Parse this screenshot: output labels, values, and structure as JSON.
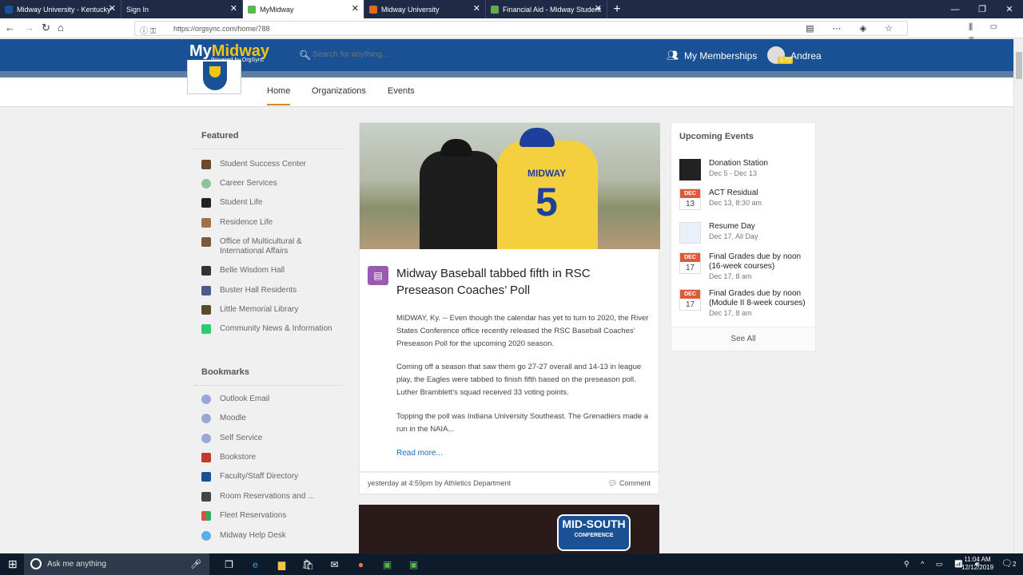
{
  "browser": {
    "tabs": [
      {
        "title": "Midway University - Kentucky",
        "fav": "#1a5094"
      },
      {
        "title": "Sign In",
        "fav": ""
      },
      {
        "title": "MyMidway",
        "fav": "#57b947"
      },
      {
        "title": "Midway University",
        "fav": "#e06b1b"
      },
      {
        "title": "Financial Aid - Midway Student",
        "fav": "#6aa84f"
      }
    ],
    "url": "https://orgsync.com/home/788"
  },
  "site": {
    "logo_my": "My",
    "logo_midway": "Midway",
    "powered": "Powered by OrgSync",
    "search_placeholder": "Search for anything...",
    "memberships": "My Memberships",
    "user": "Andrea",
    "points": "575"
  },
  "subnav": [
    "Home",
    "Organizations",
    "Events"
  ],
  "featured": {
    "title": "Featured",
    "items": [
      {
        "label": "Student Success Center",
        "color": "#6b4a2b"
      },
      {
        "label": "Career Services",
        "color": "#8bc49a"
      },
      {
        "label": "Student Life",
        "color": "#222222"
      },
      {
        "label": "Residence Life",
        "color": "#a0704a"
      },
      {
        "label": "Office of Multicultural & International Affairs",
        "color": "#7a5a3a"
      },
      {
        "label": "Belle Wisdom Hall",
        "color": "#333333"
      },
      {
        "label": "Buster Hall Residents",
        "color": "#4a5a8a"
      },
      {
        "label": "Little Memorial Library",
        "color": "#5a4a2a"
      },
      {
        "label": "Community News & Information",
        "color": "#2ecc71"
      }
    ]
  },
  "bookmarks": {
    "title": "Bookmarks",
    "items": [
      {
        "label": "Outlook Email",
        "color": "#9aa8d8"
      },
      {
        "label": "Moodle",
        "color": "#9aa8d8"
      },
      {
        "label": "Self Service",
        "color": "#9aa8d8"
      },
      {
        "label": "Bookstore",
        "color": "#c0392b"
      },
      {
        "label": "Faculty/Staff Directory",
        "color": "#1a5094"
      },
      {
        "label": "Room Reservations and ...",
        "color": "#444444"
      },
      {
        "label": "Fleet Reservations",
        "color": "#f39c12"
      },
      {
        "label": "Midway Help Desk",
        "color": "#5dade2"
      }
    ]
  },
  "post": {
    "jersey_name": "MIDWAY",
    "jersey_number": "5",
    "title": "Midway Baseball tabbed fifth in RSC Preseason Coaches’ Poll",
    "paragraphs": [
      "MIDWAY, Ky. -- Even though the calendar has yet to turn to 2020, the River States Conference office recently released the RSC Baseball Coaches’ Preseason Poll for the upcoming 2020 season.",
      "Coming off a season that saw them go 27-27 overall and 14-13 in league play, the Eagles were tabbed to finish fifth based on the preseason poll. Luther Bramblett’s squad received 33 voting points.",
      "Topping the poll was Indiana University Southeast. The Grenadiers made a run in the NAIA..."
    ],
    "read_more": "Read more...",
    "meta": "yesterday at 4:59pm by Athletics Department",
    "comment": "Comment"
  },
  "post2": {
    "badge1": "MID-SOUTH",
    "badge2": "CONFERENCE"
  },
  "events": {
    "title": "Upcoming Events",
    "items": [
      {
        "name": "Donation Station",
        "date": "Dec 5 - Dec 13",
        "mon": "",
        "day": "",
        "thumb": "donation"
      },
      {
        "name": "ACT Residual",
        "date": "Dec 13, 8:30 am",
        "mon": "DEC",
        "day": "13",
        "thumb": "cal"
      },
      {
        "name": "Resume Day",
        "date": "Dec 17, All Day",
        "mon": "",
        "day": "",
        "thumb": "resume"
      },
      {
        "name": "Final Grades due by noon (16-week courses)",
        "date": "Dec 17, 8 am",
        "mon": "DEC",
        "day": "17",
        "thumb": "cal"
      },
      {
        "name": "Final Grades due by noon (Module II 8-week courses)",
        "date": "Dec 17, 8 am",
        "mon": "DEC",
        "day": "17",
        "thumb": "cal"
      }
    ],
    "see_all": "See All"
  },
  "taskbar": {
    "search": "Ask me anything",
    "time": "11:04 AM",
    "date": "12/12/2019",
    "notif_count": "2"
  }
}
